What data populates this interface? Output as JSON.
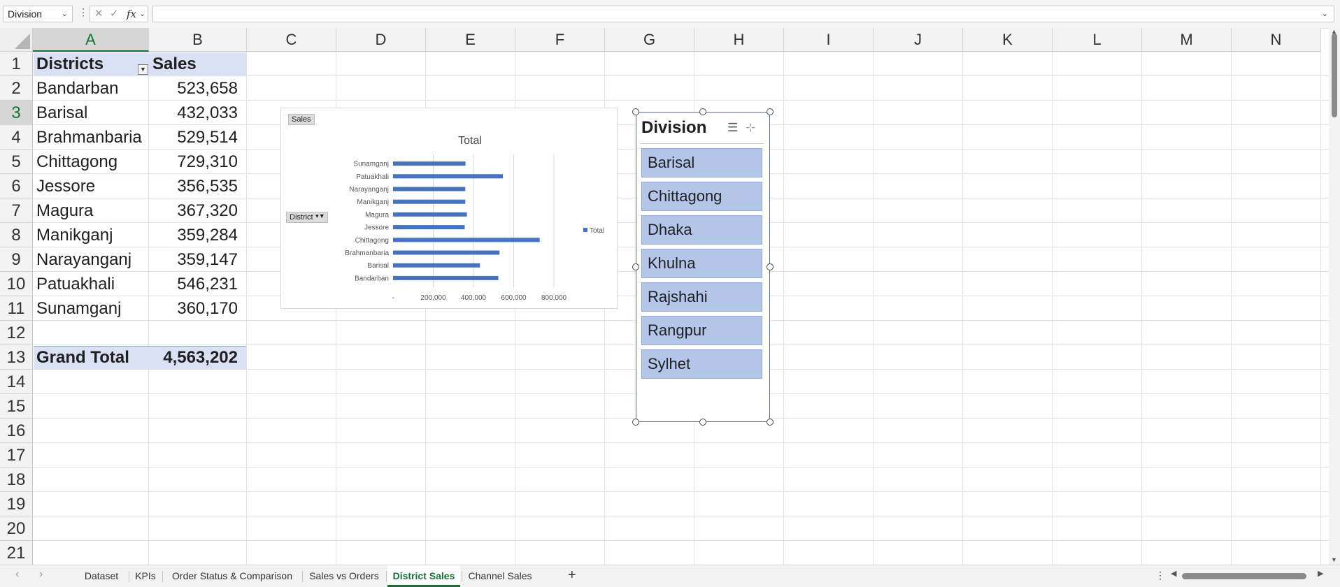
{
  "formula_bar": {
    "name_box": "Division",
    "more_icon": "⋮",
    "cancel_icon": "✕",
    "enter_icon": "✓",
    "fx_label": "fx",
    "formula_value": ""
  },
  "columns": [
    "A",
    "B",
    "C",
    "D",
    "E",
    "F",
    "G",
    "H",
    "I",
    "J",
    "K",
    "L",
    "M",
    "N"
  ],
  "rows": [
    "1",
    "2",
    "3",
    "4",
    "5",
    "6",
    "7",
    "8",
    "9",
    "10",
    "11",
    "12",
    "13",
    "14",
    "15",
    "16",
    "17",
    "18",
    "19",
    "20",
    "21"
  ],
  "pivot": {
    "header_district": "Districts",
    "header_sales": "Sales",
    "rows": [
      {
        "district": "Bandarban",
        "sales": "523,658"
      },
      {
        "district": "Barisal",
        "sales": "432,033"
      },
      {
        "district": "Brahmanbaria",
        "sales": "529,514"
      },
      {
        "district": "Chittagong",
        "sales": "729,310"
      },
      {
        "district": "Jessore",
        "sales": "356,535"
      },
      {
        "district": "Magura",
        "sales": "367,320"
      },
      {
        "district": "Manikganj",
        "sales": "359,284"
      },
      {
        "district": "Narayanganj",
        "sales": "359,147"
      },
      {
        "district": "Patuakhali",
        "sales": "546,231"
      },
      {
        "district": "Sunamganj",
        "sales": "360,170"
      }
    ],
    "total_label": "Grand Total",
    "total_value": "4,563,202"
  },
  "chart_data": {
    "type": "bar",
    "title": "Total",
    "value_field_button": "Sales",
    "axis_field_button": "District",
    "legend": "Total",
    "legend_position": "right",
    "categories": [
      "Sunamganj",
      "Patuakhali",
      "Narayanganj",
      "Manikganj",
      "Magura",
      "Jessore",
      "Chittagong",
      "Brahmanbaria",
      "Barisal",
      "Bandarban"
    ],
    "values": [
      360170,
      546231,
      359147,
      359284,
      367320,
      356535,
      729310,
      529514,
      432033,
      523658
    ],
    "xlim": [
      0,
      800000
    ],
    "xticks": [
      "-",
      "200,000",
      "400,000",
      "600,000",
      "800,000"
    ],
    "grid": true,
    "color": "#4472c4"
  },
  "slicer": {
    "title": "Division",
    "items": [
      "Barisal",
      "Chittagong",
      "Dhaka",
      "Khulna",
      "Rajshahi",
      "Rangpur",
      "Sylhet"
    ]
  },
  "tabs": [
    "Dataset",
    "KPIs",
    "Order Status & Comparison",
    "Sales vs Orders",
    "District Sales",
    "Channel Sales"
  ],
  "active_tab": "District Sales",
  "add_sheet": "+",
  "more_tabs": "⋮"
}
